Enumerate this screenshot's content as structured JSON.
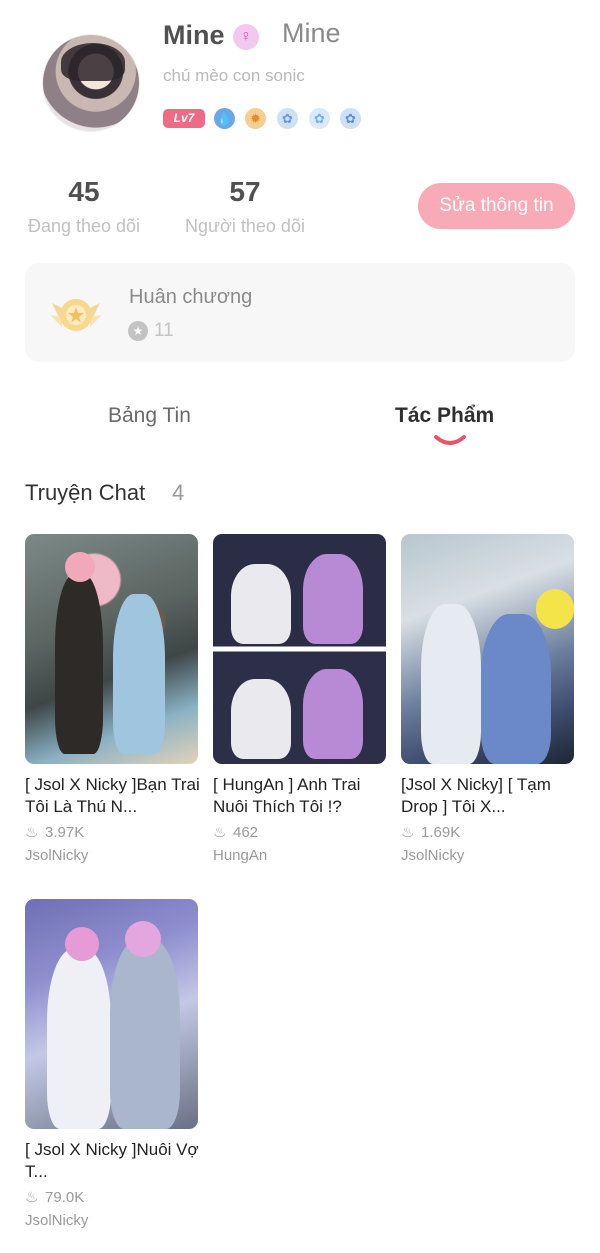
{
  "profile": {
    "name": "Mine",
    "alt_name": "Mine",
    "bio": "chú mèo con sonic",
    "level": "Lv7",
    "gender_icon": "female-symbol",
    "badges": [
      "drop-badge",
      "sun-badge",
      "blue-flower-badge",
      "blue-flower-badge",
      "blue-flower-badge"
    ]
  },
  "stats": {
    "following_count": "45",
    "following_label": "Đang theo dõi",
    "followers_count": "57",
    "followers_label": "Người theo dõi",
    "edit_button": "Sửa thông tin"
  },
  "medal": {
    "title": "Huân chương",
    "count": "11"
  },
  "tabs": {
    "feed": "Bảng Tin",
    "works": "Tác Phẩm",
    "active": "works"
  },
  "section": {
    "title": "Truyện Chat",
    "count": "4"
  },
  "stories": [
    {
      "title": "[ Jsol X Nicky ]Bạn Trai Tôi Là Thú N...",
      "views": "3.97K",
      "author": "JsolNicky"
    },
    {
      "title": "[ HungAn ] Anh Trai Nuôi Thích Tôi !?",
      "views": "462",
      "author": "HungAn"
    },
    {
      "title": "[Jsol X Nicky] [ Tạm Drop ] Tôi X...",
      "views": "1.69K",
      "author": "JsolNicky"
    },
    {
      "title": "[ Jsol X Nicky ]Nuôi Vợ T...",
      "views": "79.0K",
      "author": "JsolNicky"
    }
  ],
  "colors": {
    "accent": "#f8aab6",
    "level_badge": "#ee6b86",
    "tab_indicator": "#e8546b"
  }
}
